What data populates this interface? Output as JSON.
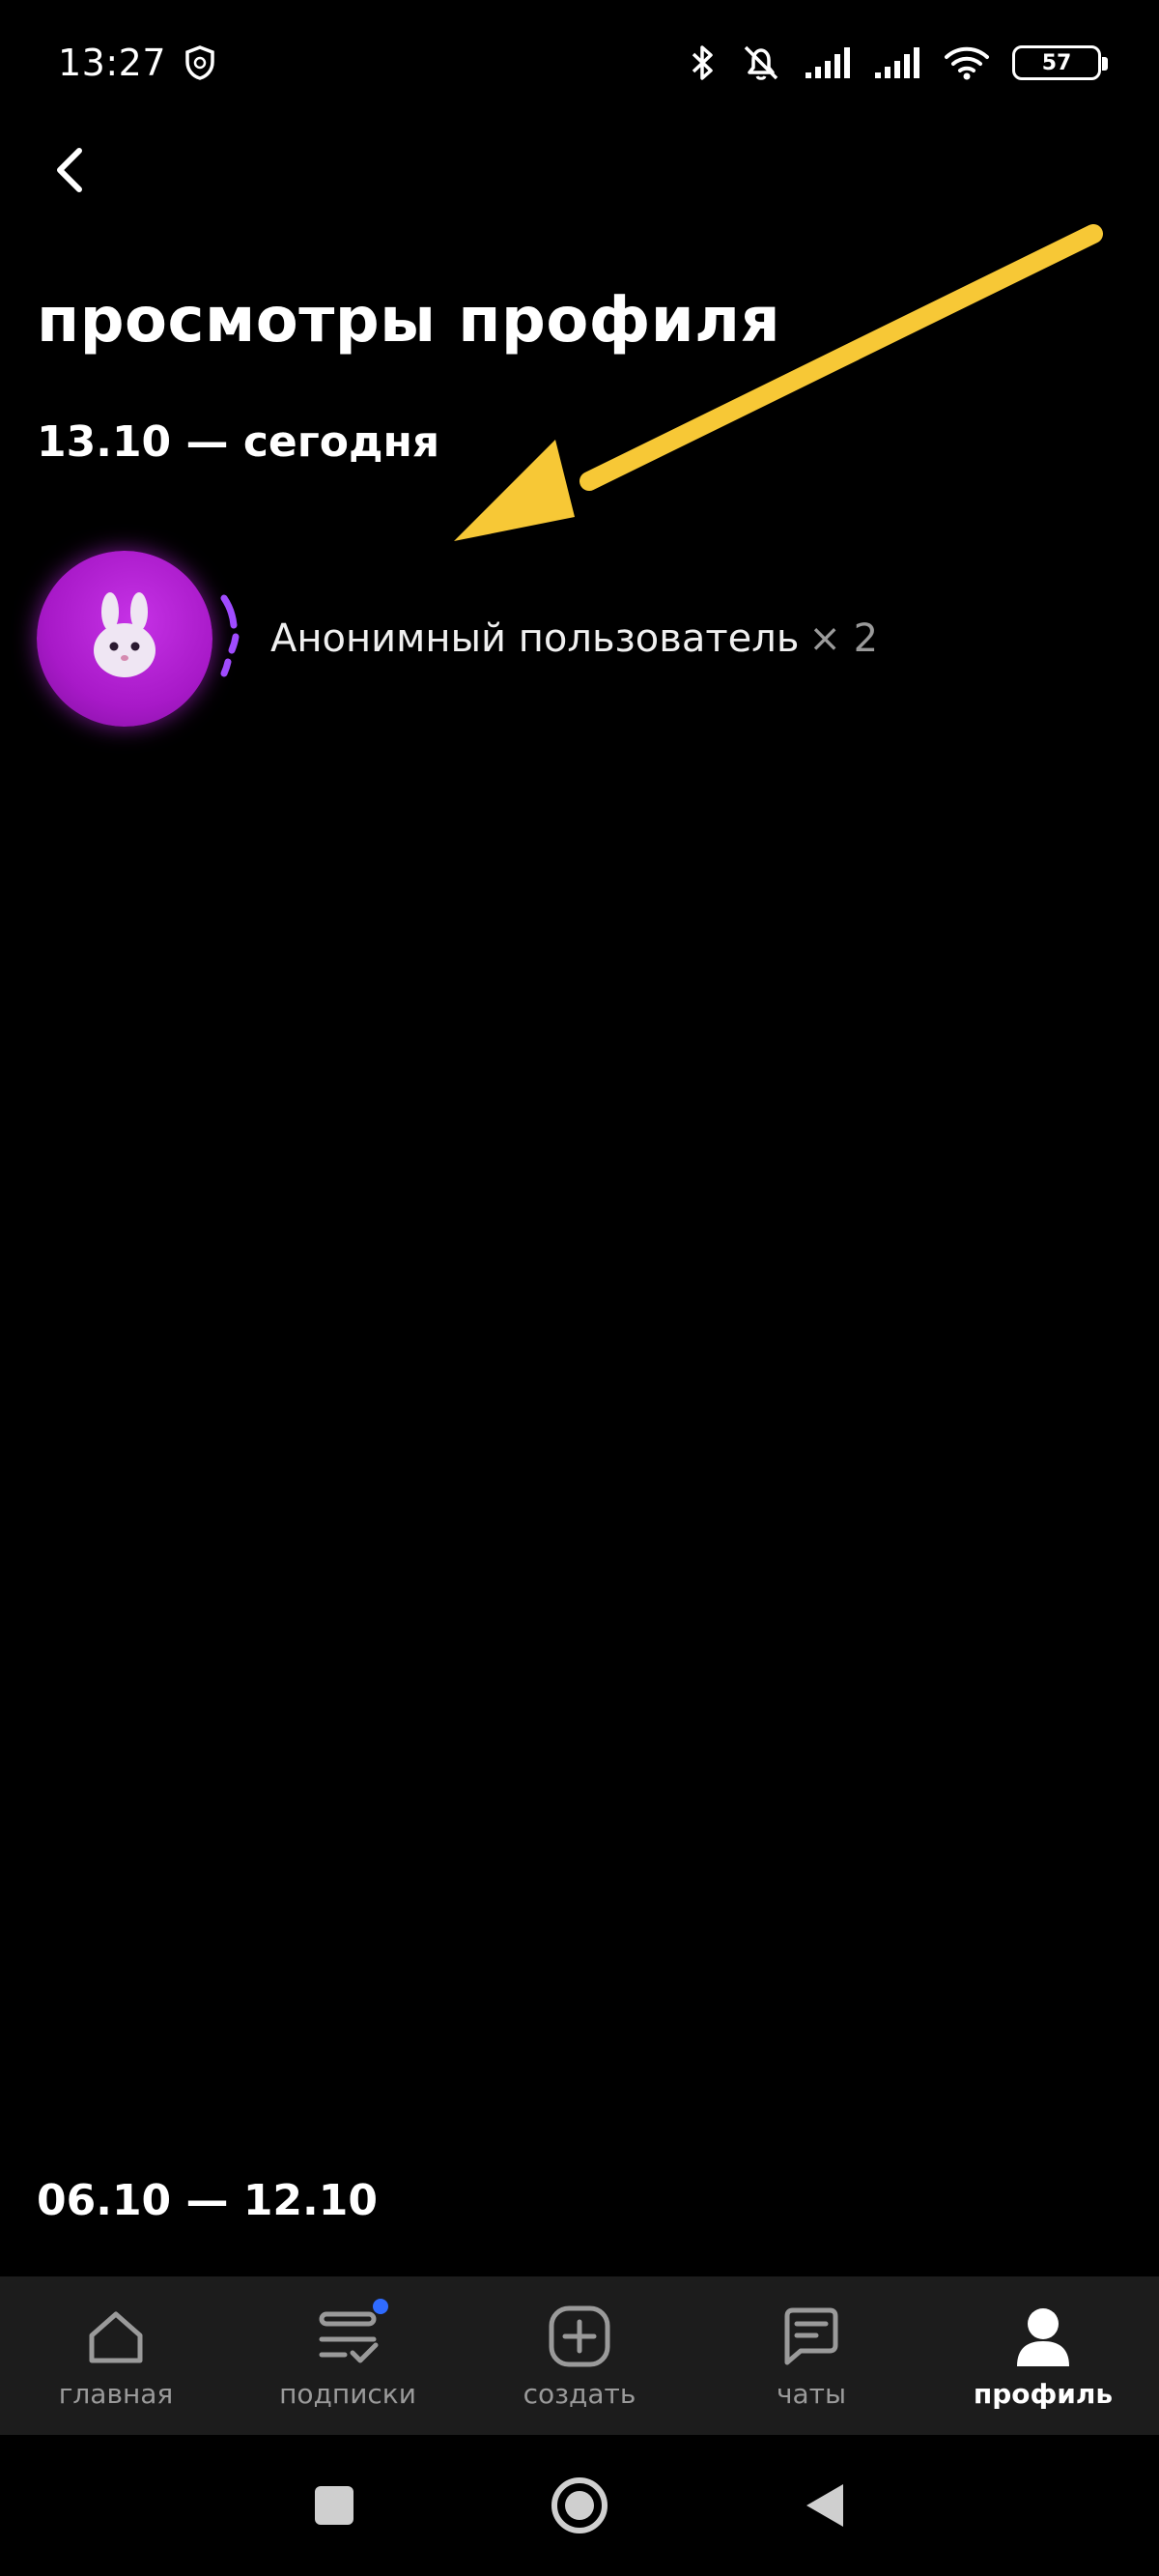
{
  "status_bar": {
    "time": "13:27",
    "battery_level": "57",
    "icons": [
      "shield-icon",
      "bluetooth-icon",
      "bell-muted-icon",
      "signal-icon",
      "signal-icon",
      "wifi-icon",
      "battery-icon"
    ]
  },
  "header": {
    "title": "просмотры профиля"
  },
  "sections": [
    {
      "date_range": "13.10 — сегодня",
      "visitors": [
        {
          "name": "Анонимный пользователь",
          "count": "× 2",
          "avatar_icon": "bunny-icon",
          "avatar_color": "#b21fd3"
        }
      ]
    },
    {
      "date_range": "06.10 — 12.10"
    }
  ],
  "annotation": {
    "arrow_color": "#f7c836"
  },
  "tab_bar": {
    "items": [
      {
        "label": "главная",
        "icon": "home-icon"
      },
      {
        "label": "подписки",
        "icon": "subscriptions-icon",
        "badge": true
      },
      {
        "label": "создать",
        "icon": "plus-square-icon"
      },
      {
        "label": "чаты",
        "icon": "chat-icon"
      },
      {
        "label": "профиль",
        "icon": "person-icon",
        "active": true
      }
    ]
  },
  "system_nav": [
    "recent-apps-icon",
    "home-circle-icon",
    "back-triangle-icon"
  ]
}
